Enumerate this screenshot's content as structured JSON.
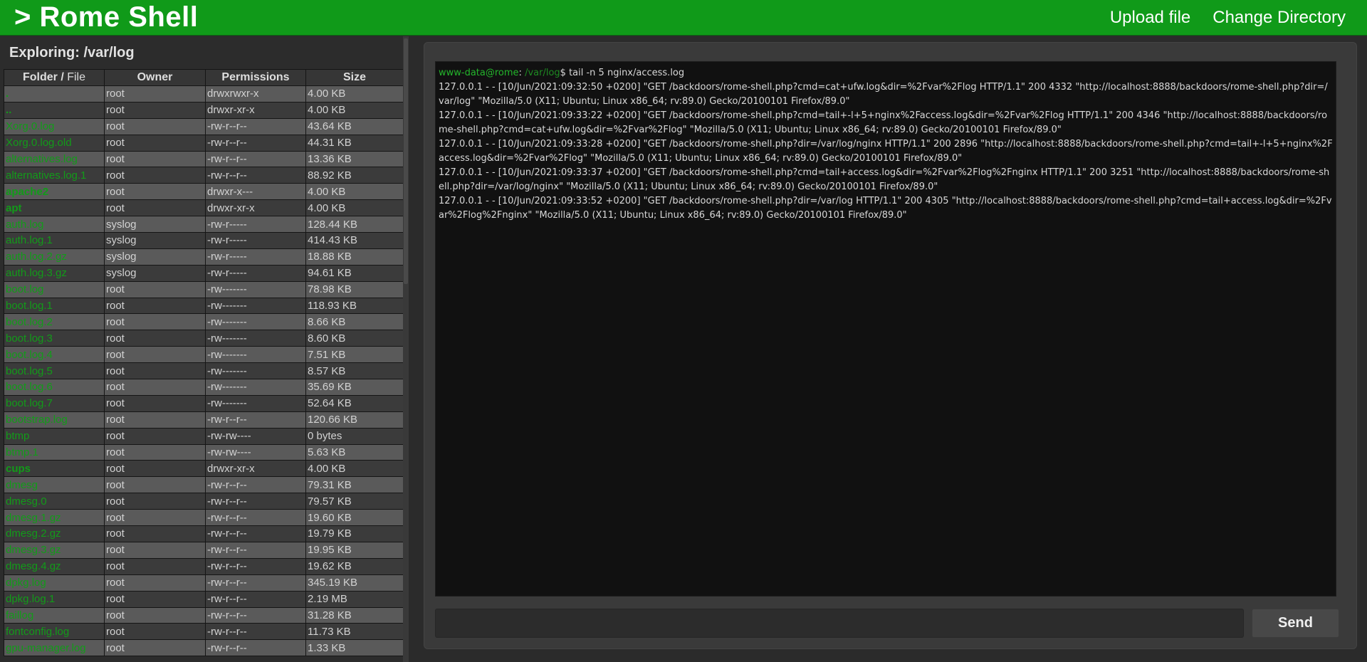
{
  "app": {
    "title": "> Rome Shell"
  },
  "nav": {
    "upload": "Upload file",
    "chdir": "Change Directory"
  },
  "explorer": {
    "title": "Exploring: /var/log",
    "headers": {
      "folder": "Folder /",
      "file": "File",
      "owner": "Owner",
      "permissions": "Permissions",
      "size": "Size"
    },
    "rows": [
      {
        "name": ".",
        "type": "folder",
        "owner": "root",
        "perm": "drwxrwxr-x",
        "size": "4.00 KB"
      },
      {
        "name": "..",
        "type": "folder",
        "owner": "root",
        "perm": "drwxr-xr-x",
        "size": "4.00 KB"
      },
      {
        "name": "Xorg.0.log",
        "type": "file",
        "owner": "root",
        "perm": "-rw-r--r--",
        "size": "43.64 KB"
      },
      {
        "name": "Xorg.0.log.old",
        "type": "file",
        "owner": "root",
        "perm": "-rw-r--r--",
        "size": "44.31 KB"
      },
      {
        "name": "alternatives.log",
        "type": "file",
        "owner": "root",
        "perm": "-rw-r--r--",
        "size": "13.36 KB"
      },
      {
        "name": "alternatives.log.1",
        "type": "file",
        "owner": "root",
        "perm": "-rw-r--r--",
        "size": "88.92 KB"
      },
      {
        "name": "apache2",
        "type": "folder",
        "owner": "root",
        "perm": "drwxr-x---",
        "size": "4.00 KB"
      },
      {
        "name": "apt",
        "type": "folder",
        "owner": "root",
        "perm": "drwxr-xr-x",
        "size": "4.00 KB"
      },
      {
        "name": "auth.log",
        "type": "file",
        "owner": "syslog",
        "perm": "-rw-r-----",
        "size": "128.44 KB"
      },
      {
        "name": "auth.log.1",
        "type": "file",
        "owner": "syslog",
        "perm": "-rw-r-----",
        "size": "414.43 KB"
      },
      {
        "name": "auth.log.2.gz",
        "type": "file",
        "owner": "syslog",
        "perm": "-rw-r-----",
        "size": "18.88 KB"
      },
      {
        "name": "auth.log.3.gz",
        "type": "file",
        "owner": "syslog",
        "perm": "-rw-r-----",
        "size": "94.61 KB"
      },
      {
        "name": "boot.log",
        "type": "file",
        "owner": "root",
        "perm": "-rw-------",
        "size": "78.98 KB"
      },
      {
        "name": "boot.log.1",
        "type": "file",
        "owner": "root",
        "perm": "-rw-------",
        "size": "118.93 KB"
      },
      {
        "name": "boot.log.2",
        "type": "file",
        "owner": "root",
        "perm": "-rw-------",
        "size": "8.66 KB"
      },
      {
        "name": "boot.log.3",
        "type": "file",
        "owner": "root",
        "perm": "-rw-------",
        "size": "8.60 KB"
      },
      {
        "name": "boot.log.4",
        "type": "file",
        "owner": "root",
        "perm": "-rw-------",
        "size": "7.51 KB"
      },
      {
        "name": "boot.log.5",
        "type": "file",
        "owner": "root",
        "perm": "-rw-------",
        "size": "8.57 KB"
      },
      {
        "name": "boot.log.6",
        "type": "file",
        "owner": "root",
        "perm": "-rw-------",
        "size": "35.69 KB"
      },
      {
        "name": "boot.log.7",
        "type": "file",
        "owner": "root",
        "perm": "-rw-------",
        "size": "52.64 KB"
      },
      {
        "name": "bootstrap.log",
        "type": "file",
        "owner": "root",
        "perm": "-rw-r--r--",
        "size": "120.66 KB"
      },
      {
        "name": "btmp",
        "type": "file",
        "owner": "root",
        "perm": "-rw-rw----",
        "size": "0 bytes"
      },
      {
        "name": "btmp.1",
        "type": "file",
        "owner": "root",
        "perm": "-rw-rw----",
        "size": "5.63 KB"
      },
      {
        "name": "cups",
        "type": "folder",
        "owner": "root",
        "perm": "drwxr-xr-x",
        "size": "4.00 KB"
      },
      {
        "name": "dmesg",
        "type": "file",
        "owner": "root",
        "perm": "-rw-r--r--",
        "size": "79.31 KB"
      },
      {
        "name": "dmesg.0",
        "type": "file",
        "owner": "root",
        "perm": "-rw-r--r--",
        "size": "79.57 KB"
      },
      {
        "name": "dmesg.1.gz",
        "type": "file",
        "owner": "root",
        "perm": "-rw-r--r--",
        "size": "19.60 KB"
      },
      {
        "name": "dmesg.2.gz",
        "type": "file",
        "owner": "root",
        "perm": "-rw-r--r--",
        "size": "19.79 KB"
      },
      {
        "name": "dmesg.3.gz",
        "type": "file",
        "owner": "root",
        "perm": "-rw-r--r--",
        "size": "19.95 KB"
      },
      {
        "name": "dmesg.4.gz",
        "type": "file",
        "owner": "root",
        "perm": "-rw-r--r--",
        "size": "19.62 KB"
      },
      {
        "name": "dpkg.log",
        "type": "file",
        "owner": "root",
        "perm": "-rw-r--r--",
        "size": "345.19 KB"
      },
      {
        "name": "dpkg.log.1",
        "type": "file",
        "owner": "root",
        "perm": "-rw-r--r--",
        "size": "2.19 MB"
      },
      {
        "name": "faillog",
        "type": "file",
        "owner": "root",
        "perm": "-rw-r--r--",
        "size": "31.28 KB"
      },
      {
        "name": "fontconfig.log",
        "type": "file",
        "owner": "root",
        "perm": "-rw-r--r--",
        "size": "11.73 KB"
      },
      {
        "name": "gpu-manager.log",
        "type": "file",
        "owner": "root",
        "perm": "-rw-r--r--",
        "size": "1.33 KB"
      }
    ]
  },
  "terminal": {
    "prompt_user": "www-data@rome",
    "prompt_sep": ":",
    "prompt_path": "/var/log",
    "prompt_end": "$ tail -n 5 nginx/access.log",
    "lines": [
      "127.0.0.1 - - [10/Jun/2021:09:32:50 +0200] \"GET /backdoors/rome-shell.php?cmd=cat+ufw.log&dir=%2Fvar%2Flog HTTP/1.1\" 200 4332 \"http://localhost:8888/backdoors/rome-shell.php?dir=/var/log\" \"Mozilla/5.0 (X11; Ubuntu; Linux x86_64; rv:89.0) Gecko/20100101 Firefox/89.0\"",
      "127.0.0.1 - - [10/Jun/2021:09:33:22 +0200] \"GET /backdoors/rome-shell.php?cmd=tail+-l+5+nginx%2Faccess.log&dir=%2Fvar%2Flog HTTP/1.1\" 200 4346 \"http://localhost:8888/backdoors/rome-shell.php?cmd=cat+ufw.log&dir=%2Fvar%2Flog\" \"Mozilla/5.0 (X11; Ubuntu; Linux x86_64; rv:89.0) Gecko/20100101 Firefox/89.0\"",
      "127.0.0.1 - - [10/Jun/2021:09:33:28 +0200] \"GET /backdoors/rome-shell.php?dir=/var/log/nginx HTTP/1.1\" 200 2896 \"http://localhost:8888/backdoors/rome-shell.php?cmd=tail+-l+5+nginx%2Faccess.log&dir=%2Fvar%2Flog\" \"Mozilla/5.0 (X11; Ubuntu; Linux x86_64; rv:89.0) Gecko/20100101 Firefox/89.0\"",
      "127.0.0.1 - - [10/Jun/2021:09:33:37 +0200] \"GET /backdoors/rome-shell.php?cmd=tail+access.log&dir=%2Fvar%2Flog%2Fnginx HTTP/1.1\" 200 3251 \"http://localhost:8888/backdoors/rome-shell.php?dir=/var/log/nginx\" \"Mozilla/5.0 (X11; Ubuntu; Linux x86_64; rv:89.0) Gecko/20100101 Firefox/89.0\"",
      "127.0.0.1 - - [10/Jun/2021:09:33:52 +0200] \"GET /backdoors/rome-shell.php?dir=/var/log HTTP/1.1\" 200 4305 \"http://localhost:8888/backdoors/rome-shell.php?cmd=tail+access.log&dir=%2Fvar%2Flog%2Fnginx\" \"Mozilla/5.0 (X11; Ubuntu; Linux x86_64; rv:89.0) Gecko/20100101 Firefox/89.0\""
    ]
  },
  "command": {
    "value": "",
    "send_label": "Send"
  },
  "colors": {
    "header": "#109a19",
    "link_green": "#129b19",
    "background": "#2b2b2b"
  }
}
